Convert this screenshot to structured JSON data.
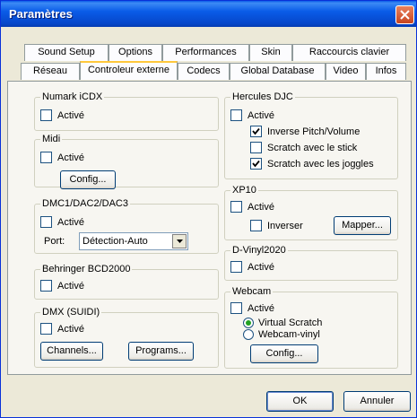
{
  "window": {
    "title": "Paramètres"
  },
  "tabs_row1": [
    "Sound Setup",
    "Options",
    "Performances",
    "Skin",
    "Raccourcis clavier"
  ],
  "tabs_row2": [
    "Réseau",
    "Controleur externe",
    "Codecs",
    "Global Database",
    "Video",
    "Infos"
  ],
  "active_tab": "Controleur externe",
  "groups": {
    "numark": {
      "title": "Numark iCDX",
      "enabled_label": "Activé",
      "enabled": false
    },
    "midi": {
      "title": "Midi",
      "enabled_label": "Activé",
      "enabled": false,
      "config_label": "Config..."
    },
    "dmc": {
      "title": "DMC1/DAC2/DAC3",
      "enabled_label": "Activé",
      "enabled": false,
      "port_label": "Port:",
      "port_value": "Détection-Auto"
    },
    "behringer": {
      "title": "Behringer BCD2000",
      "enabled_label": "Activé",
      "enabled": false
    },
    "dmx": {
      "title": "DMX (SUIDI)",
      "enabled_label": "Activé",
      "enabled": false,
      "channels_label": "Channels...",
      "programs_label": "Programs..."
    },
    "hercules": {
      "title": "Hercules DJC",
      "enabled_label": "Activé",
      "enabled": false,
      "options": [
        {
          "label": "Inverse Pitch/Volume",
          "checked": true
        },
        {
          "label": "Scratch avec le stick",
          "checked": false
        },
        {
          "label": "Scratch avec les joggles",
          "checked": true
        }
      ]
    },
    "xp10": {
      "title": "XP10",
      "enabled_label": "Activé",
      "enabled": false,
      "invert_label": "Inverser",
      "invert": false,
      "mapper_label": "Mapper..."
    },
    "dvinyl": {
      "title": "D-Vinyl2020",
      "enabled_label": "Activé",
      "enabled": false
    },
    "webcam": {
      "title": "Webcam",
      "enabled_label": "Activé",
      "enabled": false,
      "radio_virtual": "Virtual Scratch",
      "radio_vinyl": "Webcam-vinyl",
      "selected": "Virtual Scratch",
      "config_label": "Config..."
    }
  },
  "footer": {
    "ok_label": "OK",
    "cancel_label": "Annuler"
  },
  "colors": {
    "titlebar": "#0a5ce8",
    "close": "#d5582f",
    "tab_highlight": "#ffc83c",
    "check": "#21a121"
  }
}
